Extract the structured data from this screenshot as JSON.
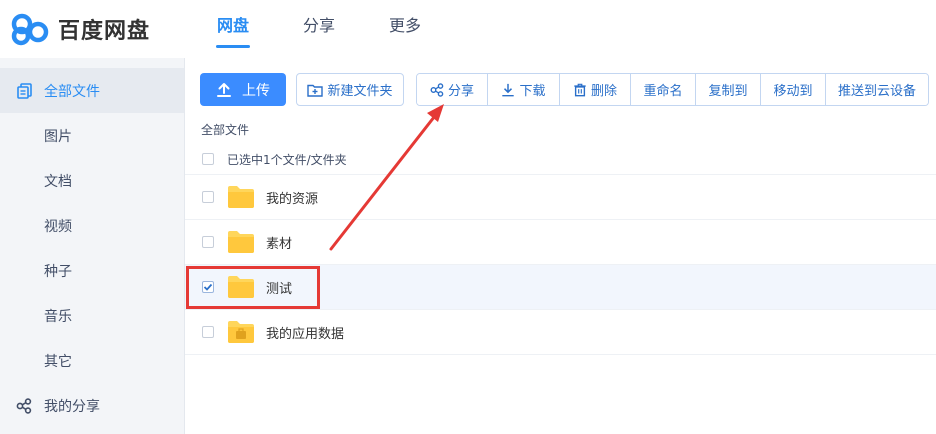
{
  "app": {
    "title": "百度网盘"
  },
  "nav": {
    "items": [
      {
        "label": "网盘",
        "active": true
      },
      {
        "label": "分享"
      },
      {
        "label": "更多"
      }
    ]
  },
  "sidebar": {
    "items": [
      {
        "label": "全部文件",
        "icon": "files-icon",
        "active": true
      },
      {
        "label": "图片"
      },
      {
        "label": "文档"
      },
      {
        "label": "视频"
      },
      {
        "label": "种子"
      },
      {
        "label": "音乐"
      },
      {
        "label": "其它"
      },
      {
        "label": "我的分享",
        "icon": "share-icon"
      }
    ]
  },
  "toolbar": {
    "upload_label": "上传",
    "new_folder_label": "新建文件夹",
    "share_label": "分享",
    "download_label": "下载",
    "delete_label": "删除",
    "rename_label": "重命名",
    "copy_label": "复制到",
    "move_label": "移动到",
    "push_label": "推送到云设备"
  },
  "breadcrumb": "全部文件",
  "list": {
    "selection_text": "已选中1个文件/文件夹",
    "files": [
      {
        "name": "我的资源",
        "checked": false
      },
      {
        "name": "素材",
        "checked": false
      },
      {
        "name": "测试",
        "checked": true
      },
      {
        "name": "我的应用数据",
        "checked": false
      }
    ]
  },
  "colors": {
    "accent": "#3b8cff",
    "sidebar_bg": "#f3f5f8",
    "annotation": "#e53935",
    "folder": "#ffd65b"
  }
}
